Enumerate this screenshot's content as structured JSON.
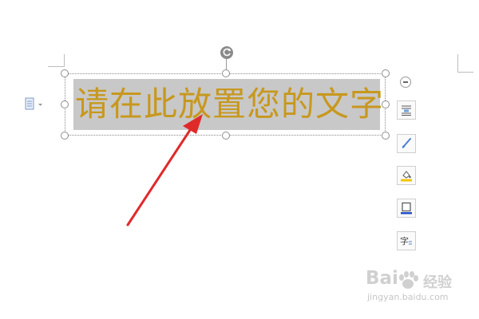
{
  "textbox": {
    "text": "请在此放置您的文字"
  },
  "toolbar": {
    "collapse": "collapse-button",
    "tools": [
      {
        "name": "text-wrap-icon"
      },
      {
        "name": "brush-icon"
      },
      {
        "name": "fill-color-icon"
      },
      {
        "name": "border-icon"
      },
      {
        "name": "text-format-icon"
      }
    ]
  },
  "watermark": {
    "brand_a": "Bai",
    "brand_b": "经验",
    "url": "jingyan.baidu.com"
  },
  "colors": {
    "text": "#c8981e",
    "text_bg": "#c8c8c8",
    "arrow": "#e02a2a"
  }
}
